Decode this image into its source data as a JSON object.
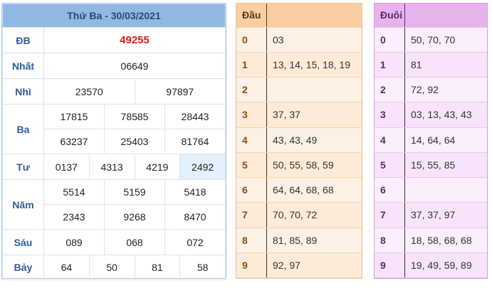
{
  "results": {
    "header": "Thứ Ba - 30/03/2021",
    "db": {
      "label": "ĐB",
      "value": "49255"
    },
    "nhat": {
      "label": "Nhất",
      "value": "06649"
    },
    "nhi": {
      "label": "Nhì",
      "values": [
        "23570",
        "97897"
      ]
    },
    "ba": {
      "label": "Ba",
      "values": [
        "17815",
        "78585",
        "28443",
        "63237",
        "25403",
        "81764"
      ]
    },
    "tu": {
      "label": "Tư",
      "values": [
        "0137",
        "4313",
        "4219",
        "2492"
      ]
    },
    "nam": {
      "label": "Năm",
      "values": [
        "5514",
        "5159",
        "5418",
        "2343",
        "9268",
        "8470"
      ]
    },
    "sau": {
      "label": "Sáu",
      "values": [
        "089",
        "068",
        "072"
      ]
    },
    "bay": {
      "label": "Bảy",
      "values": [
        "64",
        "50",
        "81",
        "58"
      ]
    }
  },
  "dau": {
    "header": "Đầu",
    "rows": [
      {
        "k": "0",
        "v": "03"
      },
      {
        "k": "1",
        "v": "13, 14, 15, 18, 19"
      },
      {
        "k": "2",
        "v": ""
      },
      {
        "k": "3",
        "v": "37, 37"
      },
      {
        "k": "4",
        "v": "43, 43, 49"
      },
      {
        "k": "5",
        "v": "50, 55, 58, 59"
      },
      {
        "k": "6",
        "v": "64, 64, 68, 68"
      },
      {
        "k": "7",
        "v": "70, 70, 72"
      },
      {
        "k": "8",
        "v": "81, 85, 89"
      },
      {
        "k": "9",
        "v": "92, 97"
      }
    ]
  },
  "duoi": {
    "header": "Đuôi",
    "rows": [
      {
        "k": "0",
        "v": "50, 70, 70"
      },
      {
        "k": "1",
        "v": "81"
      },
      {
        "k": "2",
        "v": "72, 92"
      },
      {
        "k": "3",
        "v": "03, 13, 43, 43"
      },
      {
        "k": "4",
        "v": "14, 64, 64"
      },
      {
        "k": "5",
        "v": "15, 55, 85"
      },
      {
        "k": "6",
        "v": ""
      },
      {
        "k": "7",
        "v": "37, 37, 97"
      },
      {
        "k": "8",
        "v": "18, 58, 68, 68"
      },
      {
        "k": "9",
        "v": "19, 49, 59, 89"
      }
    ]
  }
}
